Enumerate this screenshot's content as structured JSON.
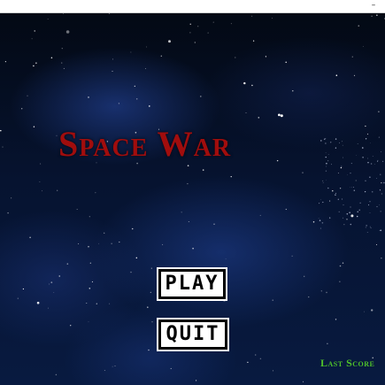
{
  "window": {
    "minimize_label": "–"
  },
  "game": {
    "title": "Space War"
  },
  "menu": {
    "play_label": "PLAY",
    "quit_label": "QUIT"
  },
  "hud": {
    "last_score_label": "Last Score"
  },
  "colors": {
    "title": "#a10d0d",
    "last_score": "#4fc12a",
    "button_face": "#ffffff",
    "button_border": "#000000"
  }
}
